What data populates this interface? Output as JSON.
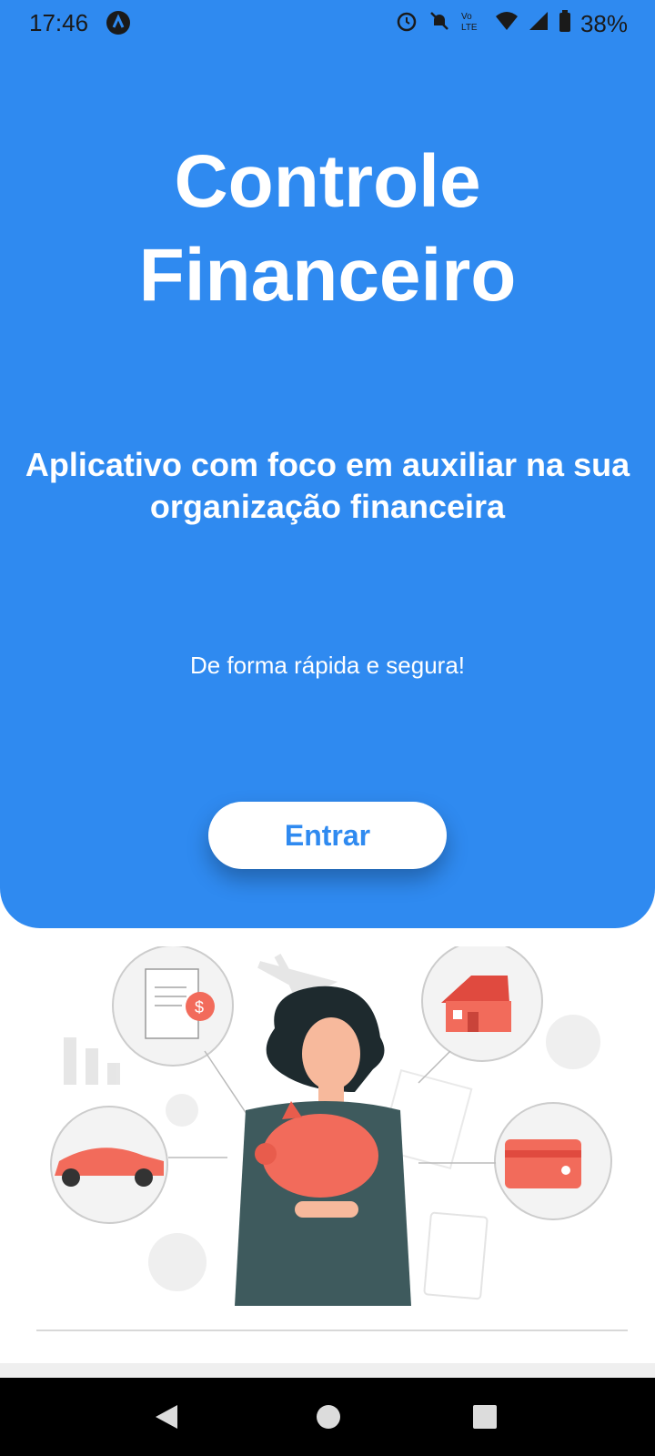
{
  "status_bar": {
    "time": "17:46",
    "battery": "38%",
    "icons": [
      "app-notification-icon",
      "alarm-icon",
      "mute-icon",
      "volte-icon",
      "wifi-icon",
      "signal-icon",
      "battery-icon"
    ]
  },
  "hero": {
    "title_line1": "Controle",
    "title_line2": "Financeiro",
    "subtitle_line1": "Aplicativo com foco em auxiliar na sua",
    "subtitle_line2": "organização financeira",
    "tagline": "De forma rápida e segura!",
    "enter_label": "Entrar"
  },
  "illustration": {
    "icons": [
      "document-dollar-icon",
      "airplane-icon",
      "house-icon",
      "bar-chart-icon",
      "coin-icon",
      "calendar-icon",
      "car-icon",
      "credit-card-icon",
      "calculator-icon",
      "woman-with-piggy-bank"
    ]
  },
  "colors": {
    "primary": "#2f8af0",
    "accent": "#f26b5b",
    "text_on_primary": "#ffffff"
  },
  "nav_bar": {
    "icons": [
      "back-icon",
      "home-icon",
      "recents-icon"
    ]
  }
}
